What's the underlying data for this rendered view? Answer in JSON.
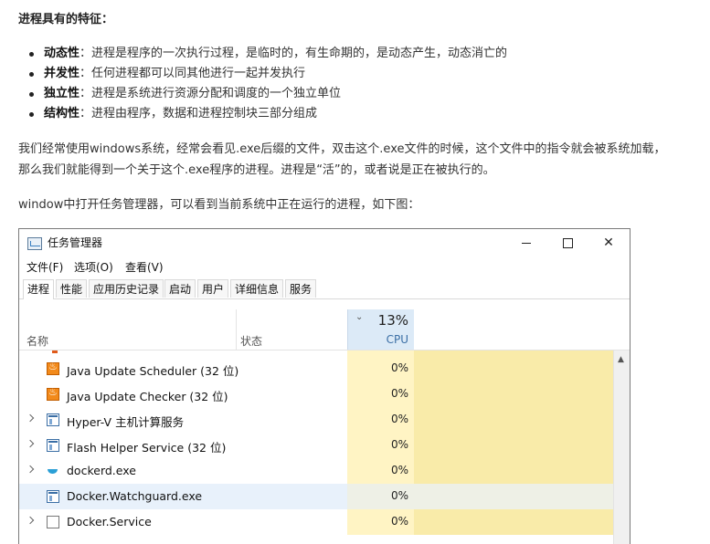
{
  "doc": {
    "title": "进程具有的特征：",
    "features": [
      {
        "term": "动态性",
        "desc": "：进程是程序的一次执行过程，是临时的，有生命期的，是动态产生，动态消亡的"
      },
      {
        "term": "并发性",
        "desc": "：任何进程都可以同其他进行一起并发执行"
      },
      {
        "term": "独立性",
        "desc": "：进程是系统进行资源分配和调度的一个独立单位"
      },
      {
        "term": "结构性",
        "desc": "：进程由程序，数据和进程控制块三部分组成"
      }
    ],
    "para1_line1": "我们经常使用windows系统，经常会看见.exe后缀的文件，双击这个.exe文件的时候，这个文件中的指令就会被系统加载，",
    "para1_line2": "那么我们就能得到一个关于这个.exe程序的进程。进程是“活”的，或者说是正在被执行的。",
    "para2": "window中打开任务管理器，可以看到当前系统中正在运行的进程，如下图："
  },
  "task_manager": {
    "title": "任务管理器",
    "window_controls": {
      "close": "✕"
    },
    "menu": [
      "文件(F)",
      "选项(O)",
      "查看(V)"
    ],
    "tabs": [
      "进程",
      "性能",
      "应用历史记录",
      "启动",
      "用户",
      "详细信息",
      "服务"
    ],
    "active_tab": "进程",
    "columns": {
      "name": "名称",
      "status": "状态",
      "cpu_percent": "13%",
      "cpu_label": "CPU"
    },
    "processes": [
      {
        "name": "Java Update Scheduler (32 位)",
        "cpu": "0%",
        "icon": "java-icon",
        "expandable": false,
        "selected": false
      },
      {
        "name": "Java Update Checker (32 位)",
        "cpu": "0%",
        "icon": "java-icon",
        "expandable": false,
        "selected": false
      },
      {
        "name": "Hyper-V 主机计算服务",
        "cpu": "0%",
        "icon": "window-icon",
        "expandable": true,
        "selected": false
      },
      {
        "name": "Flash Helper Service (32 位)",
        "cpu": "0%",
        "icon": "window-icon",
        "expandable": true,
        "selected": false
      },
      {
        "name": "dockerd.exe",
        "cpu": "0%",
        "icon": "docker-icon",
        "expandable": true,
        "selected": false
      },
      {
        "name": "Docker.Watchguard.exe",
        "cpu": "0%",
        "icon": "window-icon",
        "expandable": false,
        "selected": true
      },
      {
        "name": "Docker.Service",
        "cpu": "0%",
        "icon": "document-icon",
        "expandable": true,
        "selected": false
      }
    ],
    "colors": {
      "cpu_header_bg": "#dceaf7",
      "cpu_cell_bg": "#fff4c4",
      "selected_row_bg": "#e8f1fb"
    }
  }
}
